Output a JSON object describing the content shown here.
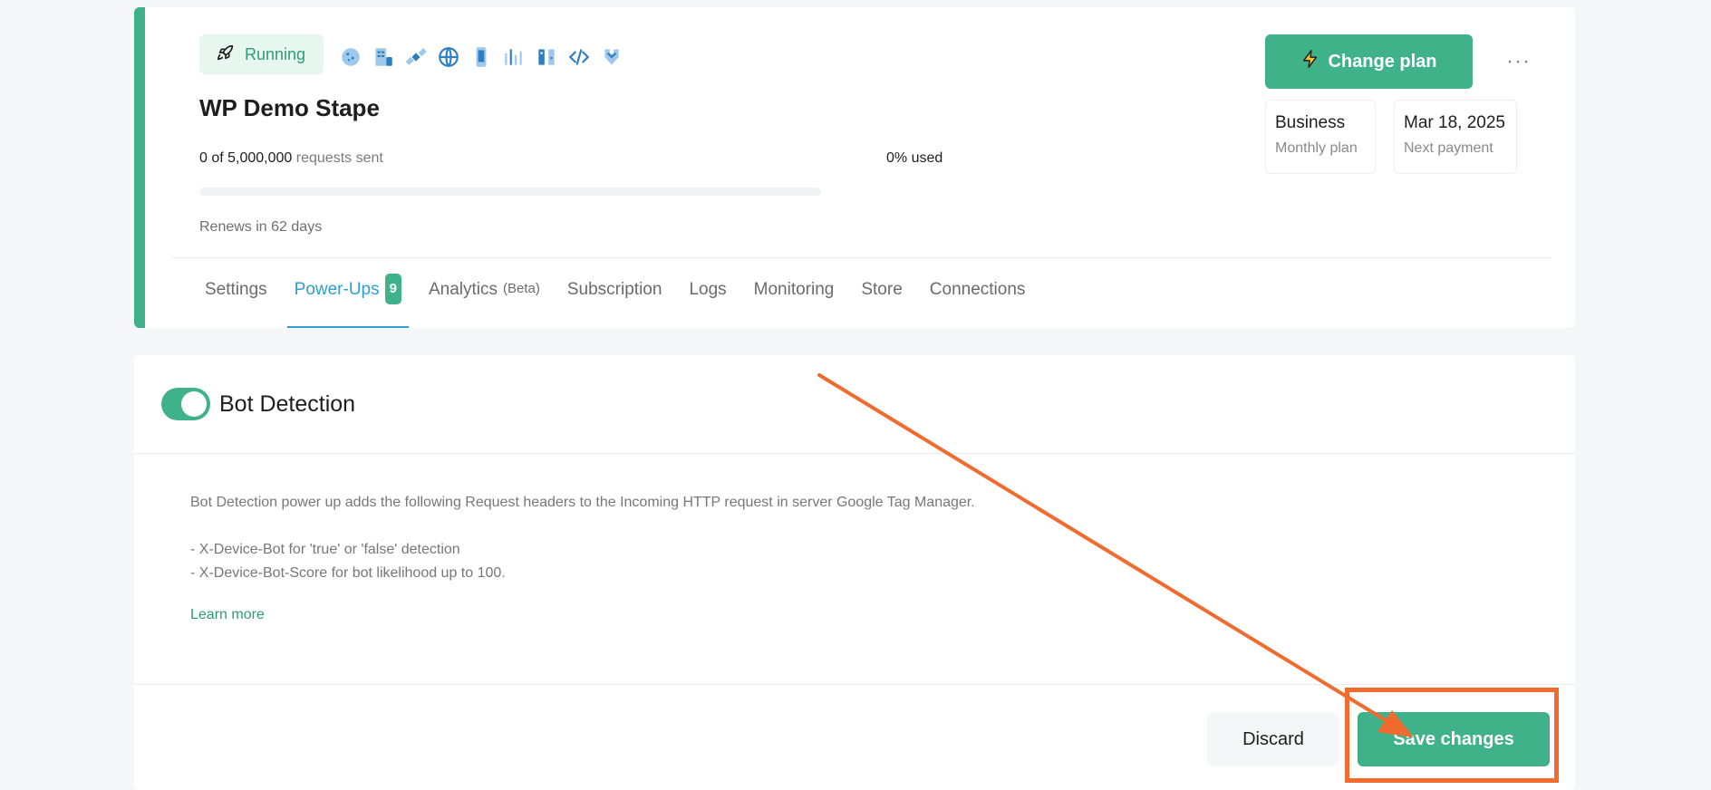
{
  "container": {
    "status": "Running",
    "name": "WP Demo Stape",
    "requests_count": "0 of 5,000,000",
    "requests_suffix": "requests sent",
    "used": "0% used",
    "usage_fraction": 0,
    "renews": "Renews in 62 days",
    "powerup_icons": [
      "cookie-icon",
      "server-icon",
      "satellite-icon",
      "globe-icon",
      "mobile-icon",
      "bars-icon",
      "database-icon",
      "code-icon",
      "puzzle-icon"
    ]
  },
  "plan": {
    "change_label": "Change plan",
    "more_label": "···",
    "plan_name": "Business",
    "plan_type": "Monthly plan",
    "next_date": "Mar 18, 2025",
    "next_label": "Next payment"
  },
  "tabs": [
    {
      "label": "Settings"
    },
    {
      "label": "Power-Ups",
      "count": "9",
      "active": true
    },
    {
      "label": "Analytics",
      "note": "(Beta)"
    },
    {
      "label": "Subscription"
    },
    {
      "label": "Logs"
    },
    {
      "label": "Monitoring"
    },
    {
      "label": "Store"
    },
    {
      "label": "Connections"
    }
  ],
  "powerup": {
    "title": "Bot Detection",
    "enabled": true,
    "desc_1": "Bot Detection power up adds the following Request headers to the Incoming HTTP request in server Google Tag Manager.",
    "desc_2": "- X-Device-Bot for 'true' or 'false' detection",
    "desc_3": "- X-Device-Bot-Score for bot likelihood up to 100.",
    "learn_more": "Learn more",
    "discard": "Discard",
    "save": "Save changes"
  },
  "colors": {
    "accent": "#3fb28a",
    "tab_active": "#2e9fd4",
    "annotation": "#f26b2e"
  }
}
